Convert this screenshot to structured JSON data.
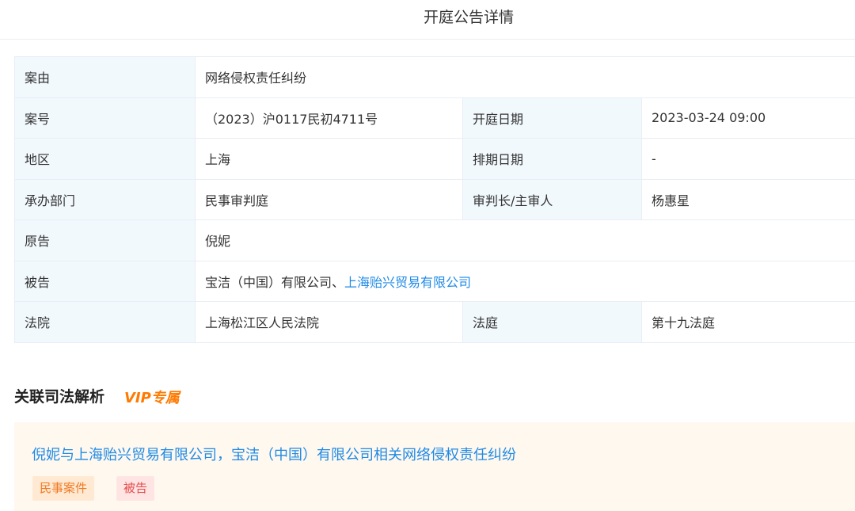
{
  "page": {
    "title": "开庭公告详情"
  },
  "detail": {
    "case_reason_label": "案由",
    "case_reason": "网络侵权责任纠纷",
    "case_no_label": "案号",
    "case_no": "（2023）沪0117民初4711号",
    "hearing_date_label": "开庭日期",
    "hearing_date": "2023-03-24 09:00",
    "region_label": "地区",
    "region": "上海",
    "schedule_date_label": "排期日期",
    "schedule_date": "-",
    "department_label": "承办部门",
    "department": "民事审判庭",
    "judge_label": "审判长/主审人",
    "judge": "杨惠星",
    "plaintiff_label": "原告",
    "plaintiff": "倪妮",
    "defendant_label": "被告",
    "defendant_1": "宝洁（中国）有限公司、",
    "defendant_2": "上海贻兴贸易有限公司",
    "court_label": "法院",
    "court": "上海松江区人民法院",
    "courtroom_label": "法庭",
    "courtroom": "第十九法庭"
  },
  "related": {
    "section_title": "关联司法解析",
    "vip_badge": "VIP专属",
    "item_title": "倪妮与上海贻兴贸易有限公司，宝洁（中国）有限公司相关网络侵权责任纠纷",
    "tag_type": "民事案件",
    "tag_role": "被告"
  },
  "colors": {
    "link": "#1f8ae6",
    "label_bg": "#f2f9fd",
    "vip": "#ff7a00",
    "card_bg": "#fff8ef"
  }
}
